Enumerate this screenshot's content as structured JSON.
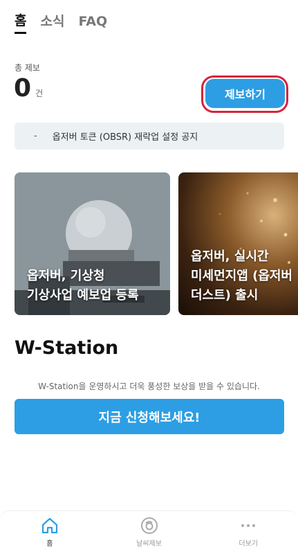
{
  "tabs": [
    "홈",
    "소식",
    "FAQ"
  ],
  "total": {
    "label": "총 제보",
    "count": "0",
    "unit": "건"
  },
  "report_button": "제보하기",
  "notice": {
    "dash": "-",
    "text": "옵저버 토큰 (OBSR) 재락업 설정 공지"
  },
  "cards": [
    {
      "title": "옵저버, 기상청\n기상사업 예보업 등록"
    },
    {
      "title": "옵저버, 실시간\n미세먼지앱 (옵저버\n더스트) 출시"
    }
  ],
  "wstation": {
    "title": "W-Station",
    "description": "W-Station을 운영하시고 더욱 풍성한 보상을 받을 수 있습니다.",
    "apply_button": "지금 신청해보세요!"
  },
  "bottom_nav": [
    {
      "label": "홈",
      "icon": "home-icon",
      "active": true
    },
    {
      "label": "날씨제보",
      "icon": "weather-report-icon",
      "active": false
    },
    {
      "label": "더보기",
      "icon": "more-icon",
      "active": false
    }
  ],
  "colors": {
    "accent": "#2d9ee4",
    "highlight": "#d6243a",
    "notice_bg": "#ecf1f4"
  }
}
